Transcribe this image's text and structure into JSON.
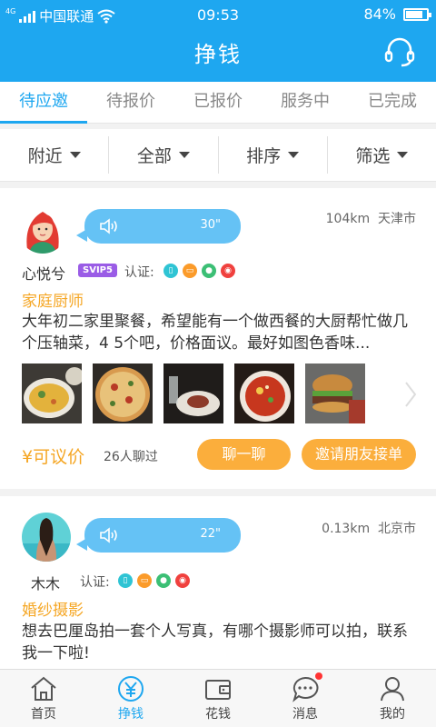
{
  "status": {
    "network": "4G",
    "carrier": "中国联通",
    "time": "09:53",
    "battery": "84%",
    "battery_level": 0.84
  },
  "header": {
    "title": "挣钱",
    "service_icon": "headset-icon"
  },
  "tabs": [
    {
      "label": "待应邀",
      "active": true
    },
    {
      "label": "待报价"
    },
    {
      "label": "已报价"
    },
    {
      "label": "服务中"
    },
    {
      "label": "已完成"
    }
  ],
  "filters": [
    {
      "label": "附近"
    },
    {
      "label": "全部"
    },
    {
      "label": "排序"
    },
    {
      "label": "筛选"
    }
  ],
  "cards": [
    {
      "voice_duration": "30\"",
      "distance": "104km",
      "city": "天津市",
      "user": "心悦兮",
      "badge": "SVIP5",
      "cert_label": "认证:",
      "category": "家庭厨师",
      "description": "大年初二家里聚餐，希望能有一个做西餐的大厨帮忙做几个压轴菜，4 5个吧，价格面议。最好如图色香味...",
      "price": "¥可议价",
      "chat_count": "26人聊过",
      "chat_button": "聊一聊",
      "invite_button": "邀请朋友接单"
    },
    {
      "voice_duration": "22\"",
      "distance": "0.13km",
      "city": "北京市",
      "user": "木木",
      "cert_label": "认证:",
      "category": "婚纱摄影",
      "description": "想去巴厘岛拍一套个人写真，有哪个摄影师可以拍，联系我一下啦!"
    }
  ],
  "bottom_nav": [
    {
      "label": "首页",
      "icon": "home-icon"
    },
    {
      "label": "挣钱",
      "icon": "yen-icon",
      "active": true
    },
    {
      "label": "花钱",
      "icon": "wallet-icon"
    },
    {
      "label": "消息",
      "icon": "message-icon",
      "has_dot": true
    },
    {
      "label": "我的",
      "icon": "profile-icon"
    }
  ],
  "colors": {
    "primary": "#1ea7f0",
    "accent": "#fbae3c",
    "vip": "#9a5ce6"
  }
}
